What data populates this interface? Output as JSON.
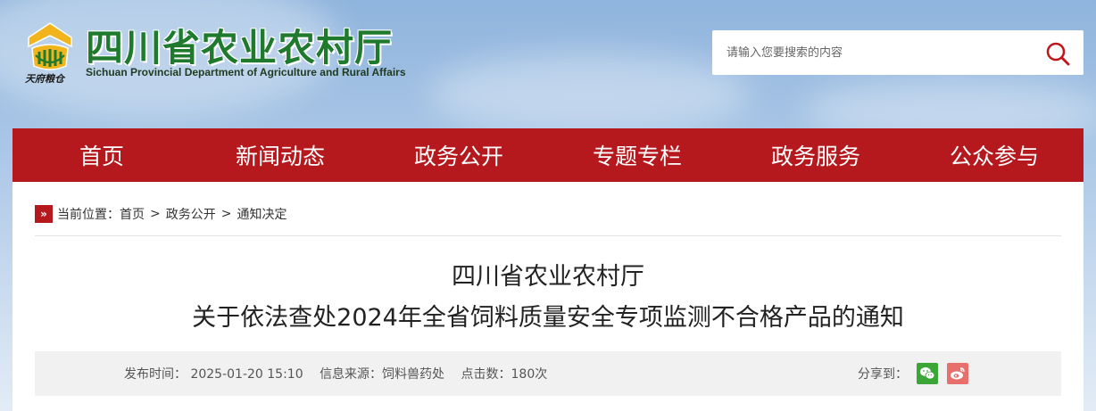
{
  "header": {
    "emblem_text": "天府粮仓",
    "title": "四川省农业农村厅",
    "subtitle": "Sichuan Provincial Department of Agriculture and Rural Affairs",
    "search": {
      "placeholder": "请输入您要搜索的内容",
      "icon": "search-icon"
    }
  },
  "nav": {
    "items": [
      {
        "label": "首页"
      },
      {
        "label": "新闻动态"
      },
      {
        "label": "政务公开"
      },
      {
        "label": "专题专栏"
      },
      {
        "label": "政务服务"
      },
      {
        "label": "公众参与"
      }
    ]
  },
  "breadcrumb": {
    "icon": "double-chevron-icon",
    "prefix": "当前位置：",
    "items": [
      "首页",
      "政务公开",
      "通知决定"
    ],
    "separator": ">"
  },
  "article": {
    "title_line1": "四川省农业农村厅",
    "title_line2": "关于依法查处2024年全省饲料质量安全专项监测不合格产品的通知",
    "publish_time": "发布时间： 2025-01-20 15:10",
    "source": "信息来源：饲料兽药处",
    "clicks": "点击数：180次",
    "share_label": "分享到：",
    "share_icons": [
      "wechat-icon",
      "weibo-icon"
    ]
  },
  "colors": {
    "nav_red": "#b5191d",
    "title_green": "#1f7a2e",
    "wechat_green": "#3aa635",
    "weibo_pink": "#e8706c"
  }
}
